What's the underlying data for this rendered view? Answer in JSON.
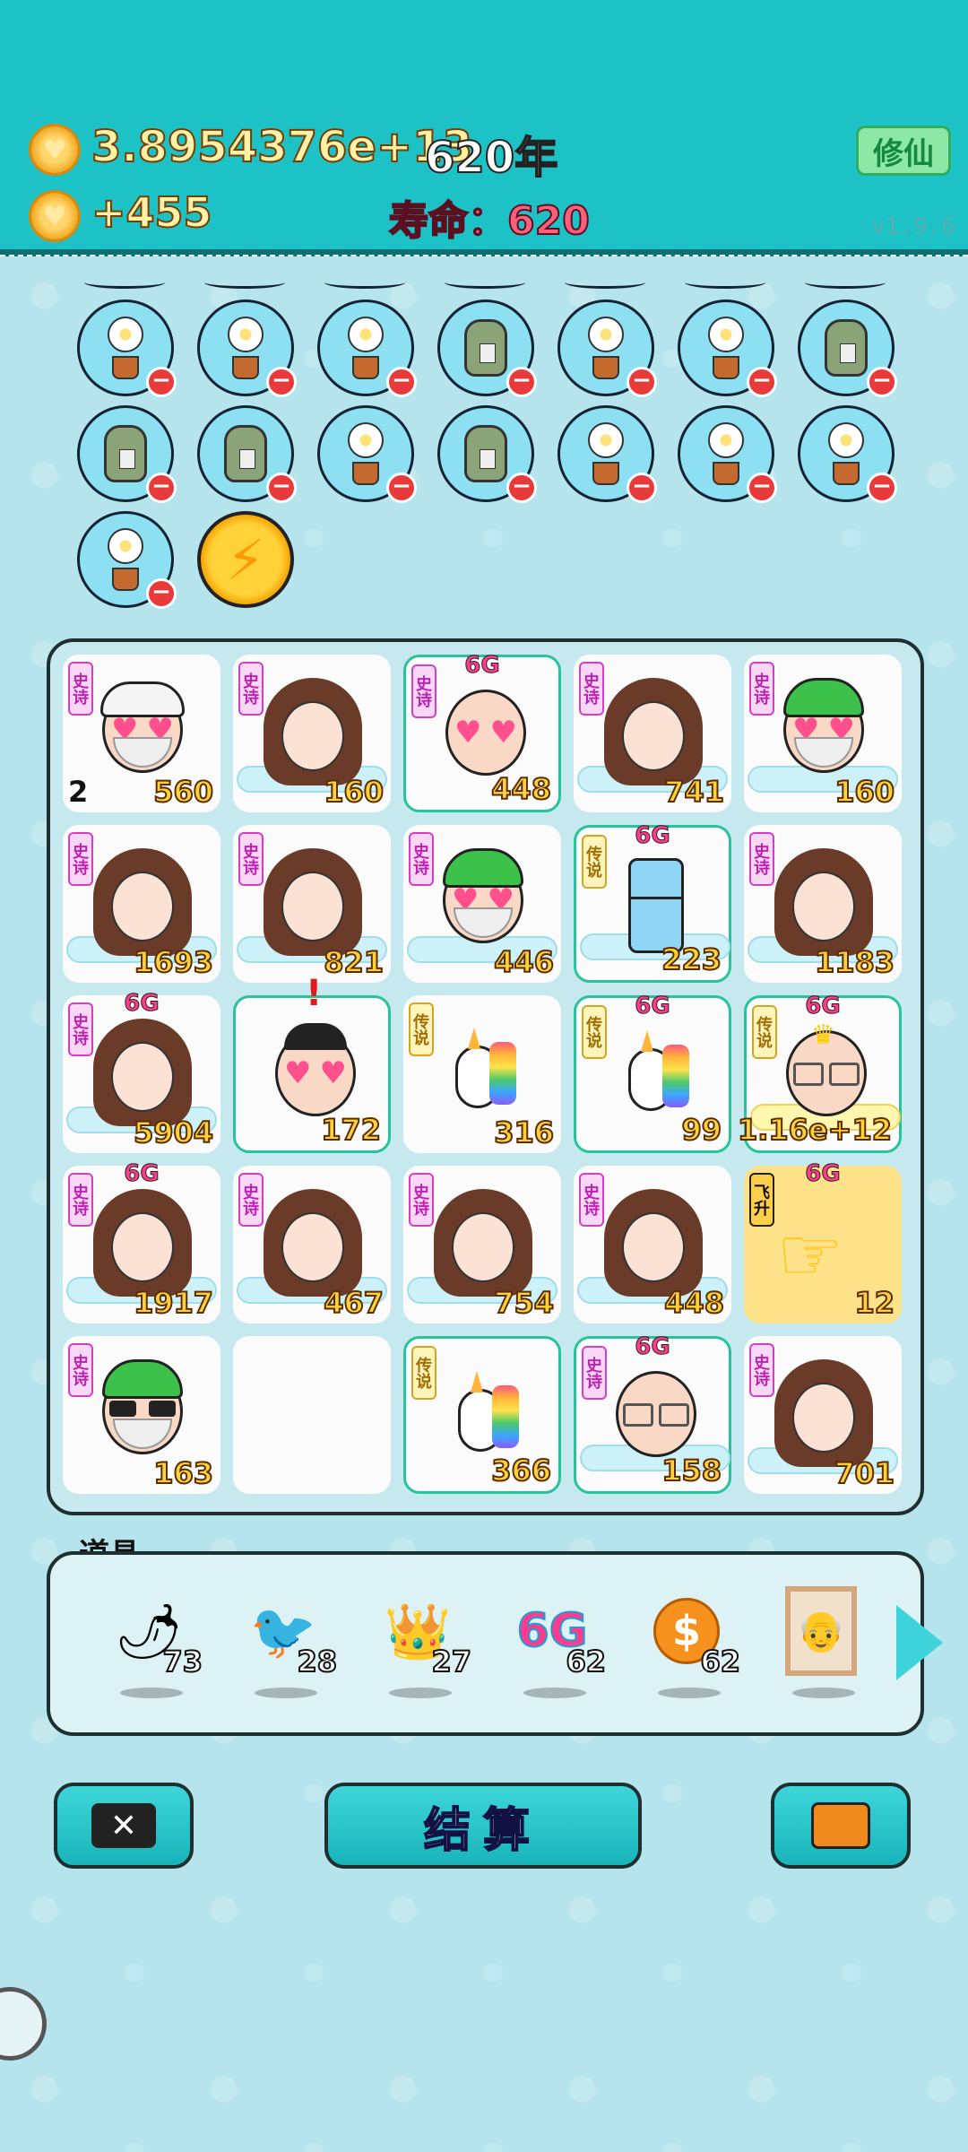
{
  "header": {
    "coins": "3.8954376e+13",
    "years": "620年",
    "income": "+455",
    "lifespan": "寿命：620",
    "cultivate_button": "修仙",
    "version": "v1.9.6"
  },
  "bubbles": {
    "row1": [
      "flower",
      "flower",
      "flower",
      "bag",
      "flower",
      "flower",
      "bag"
    ],
    "row2": [
      "bag",
      "bag",
      "flower",
      "bag",
      "flower",
      "flower",
      "flower"
    ],
    "row3": [
      "flower",
      "lightning"
    ],
    "remove_icon": "minus-icon"
  },
  "grid": {
    "cells": [
      {
        "tag": "史诗",
        "value": "560",
        "index": "2",
        "char": "old-white-heart"
      },
      {
        "tag": "史诗",
        "value": "160",
        "char": "girl"
      },
      {
        "tag": "史诗",
        "value": "448",
        "badge": "6G",
        "char": "bald-heart",
        "hl": true
      },
      {
        "tag": "史诗",
        "value": "741",
        "char": "girl"
      },
      {
        "tag": "史诗",
        "value": "160",
        "char": "green-heart"
      },
      {
        "tag": "史诗",
        "value": "1693",
        "char": "girl"
      },
      {
        "tag": "史诗",
        "value": "821",
        "char": "girl"
      },
      {
        "tag": "史诗",
        "value": "446",
        "char": "green-heart"
      },
      {
        "tag": "传说",
        "value": "223",
        "badge": "6G",
        "char": "fridge",
        "hl": true
      },
      {
        "tag": "史诗",
        "value": "1183",
        "char": "girl"
      },
      {
        "tag": "史诗",
        "value": "5904",
        "badge": "6G",
        "char": "girl"
      },
      {
        "value": "172",
        "alert": "!",
        "char": "black-heart",
        "hl": true
      },
      {
        "tag": "传说",
        "value": "316",
        "char": "unicorn"
      },
      {
        "tag": "传说",
        "value": "99",
        "badge": "6G",
        "char": "unicorn",
        "hl": true
      },
      {
        "tag": "传说",
        "value": "1.16e+12",
        "badge": "6G",
        "char": "crown-king",
        "hl": true
      },
      {
        "tag": "史诗",
        "value": "1917",
        "badge": "6G",
        "char": "girl"
      },
      {
        "tag": "史诗",
        "value": "467",
        "char": "girl"
      },
      {
        "tag": "史诗",
        "value": "754",
        "char": "girl"
      },
      {
        "tag": "史诗",
        "value": "448",
        "char": "girl"
      },
      {
        "tag": "飞升",
        "value": "12",
        "badge": "6G",
        "char": "hand",
        "gold": true
      },
      {
        "tag": "史诗",
        "value": "163",
        "char": "green-dark"
      },
      {
        "empty": true
      },
      {
        "tag": "传说",
        "value": "366",
        "char": "unicorn",
        "hl": true
      },
      {
        "tag": "史诗",
        "value": "158",
        "badge": "6G",
        "char": "bald-glasses",
        "hl": true
      },
      {
        "tag": "史诗",
        "value": "701",
        "char": "girl"
      }
    ]
  },
  "items": {
    "label": "道具",
    "list": [
      {
        "icon": "chili-icon",
        "count": "73"
      },
      {
        "icon": "duck-icon",
        "count": "28"
      },
      {
        "icon": "crown-icon",
        "count": "27"
      },
      {
        "icon": "6g-icon",
        "count": "62",
        "text": "6G"
      },
      {
        "icon": "coin-icon",
        "count": "62"
      },
      {
        "icon": "portrait-icon",
        "count": ""
      }
    ]
  },
  "buttons": {
    "settle": "结算"
  },
  "colors": {
    "header_bg": "#1cc2c6",
    "page_bg": "#b6e4ec",
    "value_text": "#ffd23a",
    "epic_tag": "#c021b5",
    "legend_tag": "#a06f00"
  }
}
